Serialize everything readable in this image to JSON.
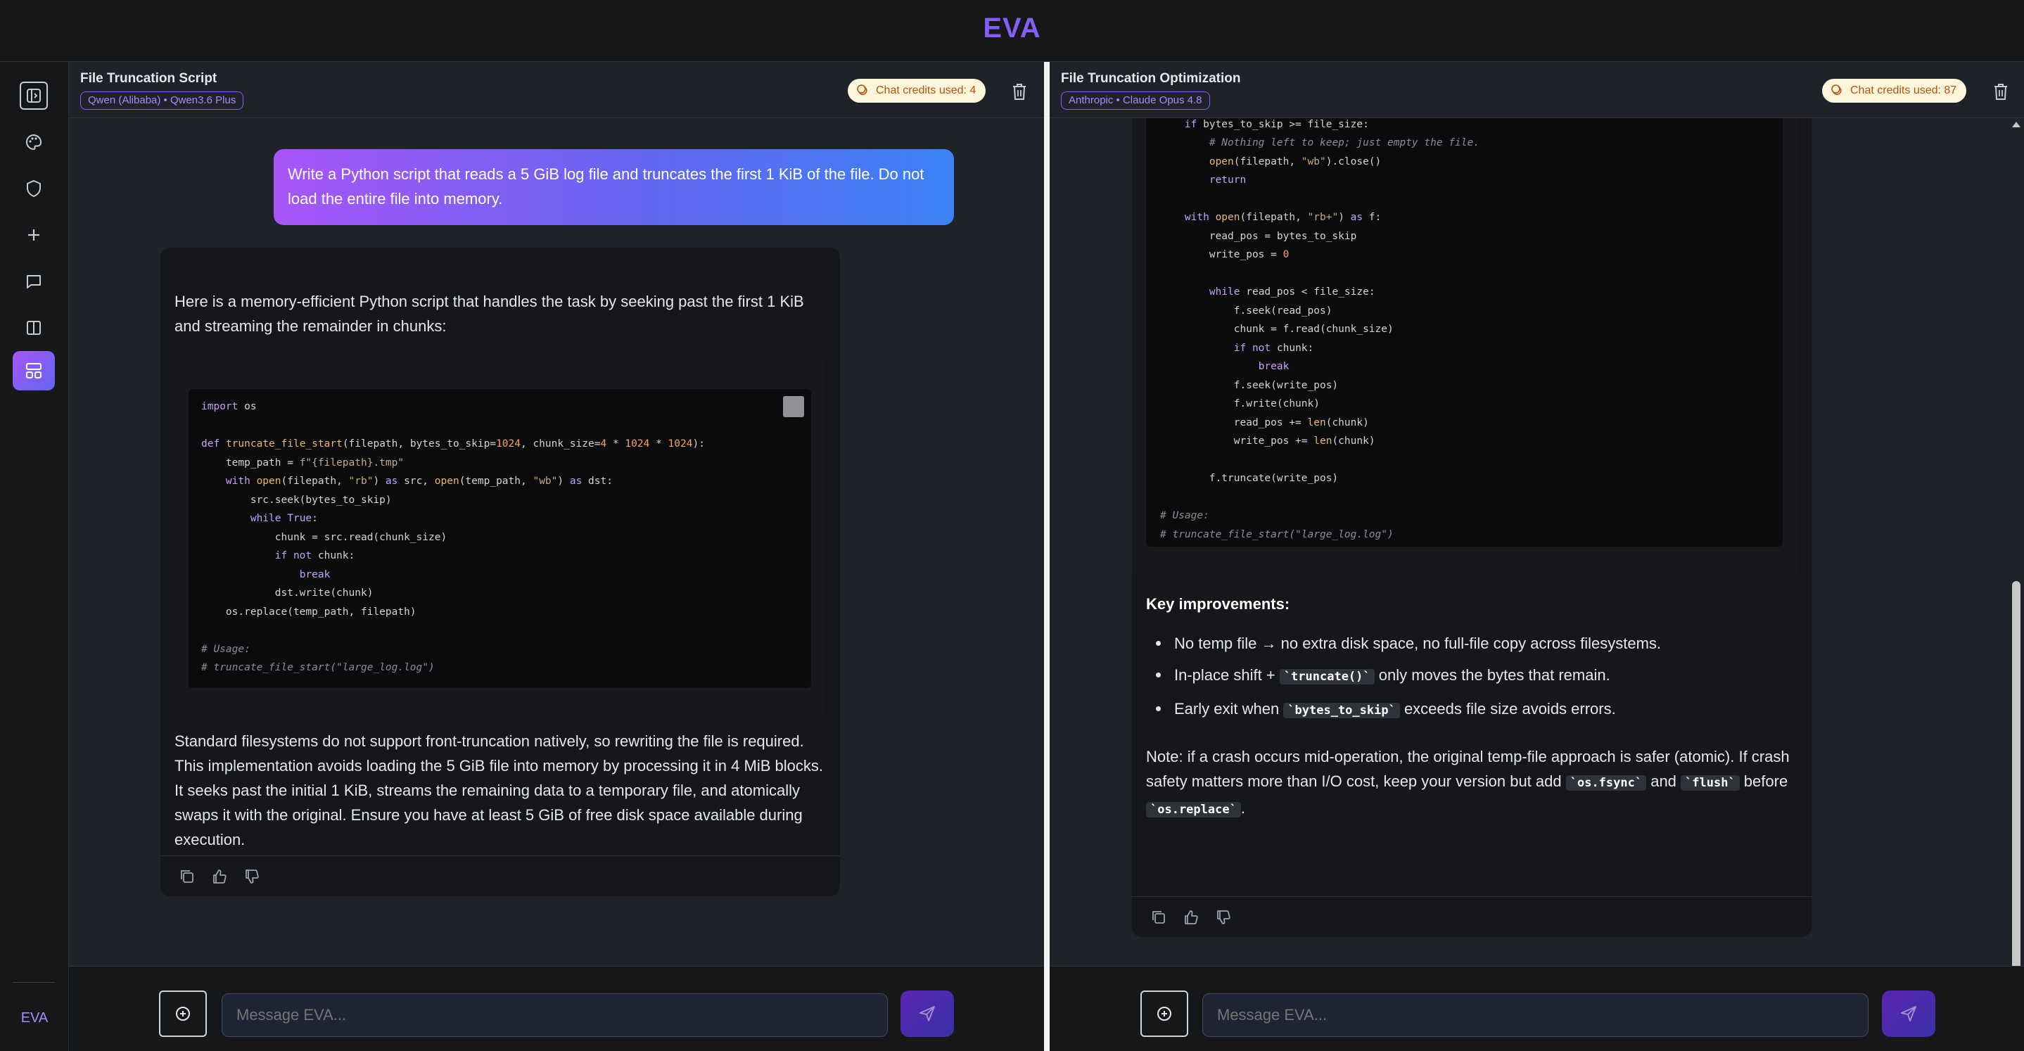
{
  "app": {
    "brand": "EVA",
    "rail_footer": "EVA"
  },
  "rail": {
    "items": [
      {
        "icon": "sidebar-toggle-icon"
      },
      {
        "icon": "palette-icon"
      },
      {
        "icon": "shield-icon"
      },
      {
        "icon": "plus-icon"
      },
      {
        "icon": "chat-icon"
      },
      {
        "icon": "split-view-icon"
      },
      {
        "icon": "dashboard-icon",
        "active": true
      }
    ]
  },
  "left": {
    "title": "File Truncation Script",
    "model": "Qwen (Alibaba) • Qwen3.6 Plus",
    "credits": "Chat credits used: 4",
    "user_message": "Write a Python script that reads a 5 GiB log file and truncates the first 1 KiB of the file. Do not load the entire file into memory.",
    "intro": "Here is a memory-efficient Python script that handles the task by seeking past the first 1 KiB and streaming the remainder in chunks:",
    "outro": "Standard filesystems do not support front-truncation natively, so rewriting the file is required. This implementation avoids loading the 5 GiB file into memory by processing it in 4 MiB blocks. It seeks past the initial 1 KiB, streams the remaining data to a temporary file, and atomically swaps it with the original. Ensure you have at least 5 GiB of free disk space available during execution.",
    "input_placeholder": "Message EVA..."
  },
  "right": {
    "title": "File Truncation Optimization",
    "model": "Anthropic • Claude Opus 4.8",
    "credits": "Chat credits used: 87",
    "key_title": "Key improvements:",
    "b1": "No temp file → no extra disk space, no full-file copy across filesystems.",
    "b2_pre": "In-place shift + ",
    "b2_code": "`truncate()`",
    "b2_post": " only moves the bytes that remain.",
    "b3_pre": "Early exit when ",
    "b3_code": "`bytes_to_skip`",
    "b3_post": " exceeds file size avoids errors.",
    "note_pre": "Note: if a crash occurs mid-operation, the original temp-file approach is safer (atomic). If crash safety matters more than I/O cost, keep your version but add ",
    "note_code1": "`os.fsync`",
    "note_mid": " and ",
    "note_code2": "`flush`",
    "note_post": " before ",
    "note_code3": "`os.replace`",
    "note_end": ".",
    "input_placeholder": "Message EVA..."
  },
  "colors": {
    "accent_start": "#a855f7",
    "accent_end": "#3b82f6",
    "credits_bg": "#fdf6dc",
    "credits_text": "#b45309"
  }
}
